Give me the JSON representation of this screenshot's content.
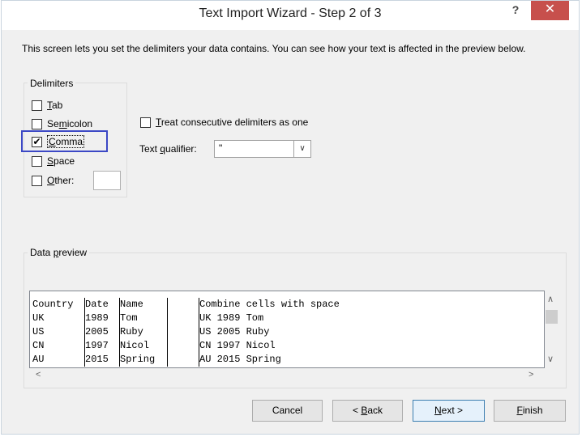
{
  "window": {
    "title": "Text Import Wizard - Step 2 of 3",
    "help_label": "?",
    "close_label": "✕"
  },
  "description": "This screen lets you set the delimiters your data contains.  You can see how your text is affected in the preview below.",
  "delimiters": {
    "group_label": "Delimiters",
    "tab": {
      "label_key": "T",
      "label_rest": "ab",
      "checked": false
    },
    "semicolon": {
      "label_pre": "Se",
      "label_key": "m",
      "label_rest": "icolon",
      "checked": false
    },
    "comma": {
      "label_key": "C",
      "label_rest": "omma",
      "checked": true
    },
    "space": {
      "label_key": "S",
      "label_rest": "pace",
      "checked": false
    },
    "other": {
      "label_key": "O",
      "label_rest": "ther:",
      "checked": false,
      "value": ""
    }
  },
  "consecutive": {
    "label_key": "T",
    "label_rest": "reat consecutive delimiters as one",
    "checked": false
  },
  "qualifier": {
    "label_pre": "Text ",
    "label_key": "q",
    "label_rest": "ualifier:",
    "value": "\""
  },
  "preview": {
    "group_label_pre": "Data ",
    "group_label_key": "p",
    "group_label_rest": "review",
    "rows": [
      [
        "Country",
        "Date",
        "Name",
        "",
        "Combine cells with space"
      ],
      [
        "UK",
        "1989",
        "Tom",
        "",
        "UK 1989 Tom"
      ],
      [
        "US",
        "2005",
        "Ruby",
        "",
        "US 2005 Ruby"
      ],
      [
        "CN",
        "1997",
        "Nicol",
        "",
        "CN 1997 Nicol"
      ],
      [
        "AU",
        "2015",
        "Spring",
        "",
        "AU 2015 Spring"
      ]
    ]
  },
  "buttons": {
    "cancel": "Cancel",
    "back_pre": "< ",
    "back_key": "B",
    "back_rest": "ack",
    "next_key": "N",
    "next_rest": "ext >",
    "finish_key": "F",
    "finish_rest": "inish"
  }
}
